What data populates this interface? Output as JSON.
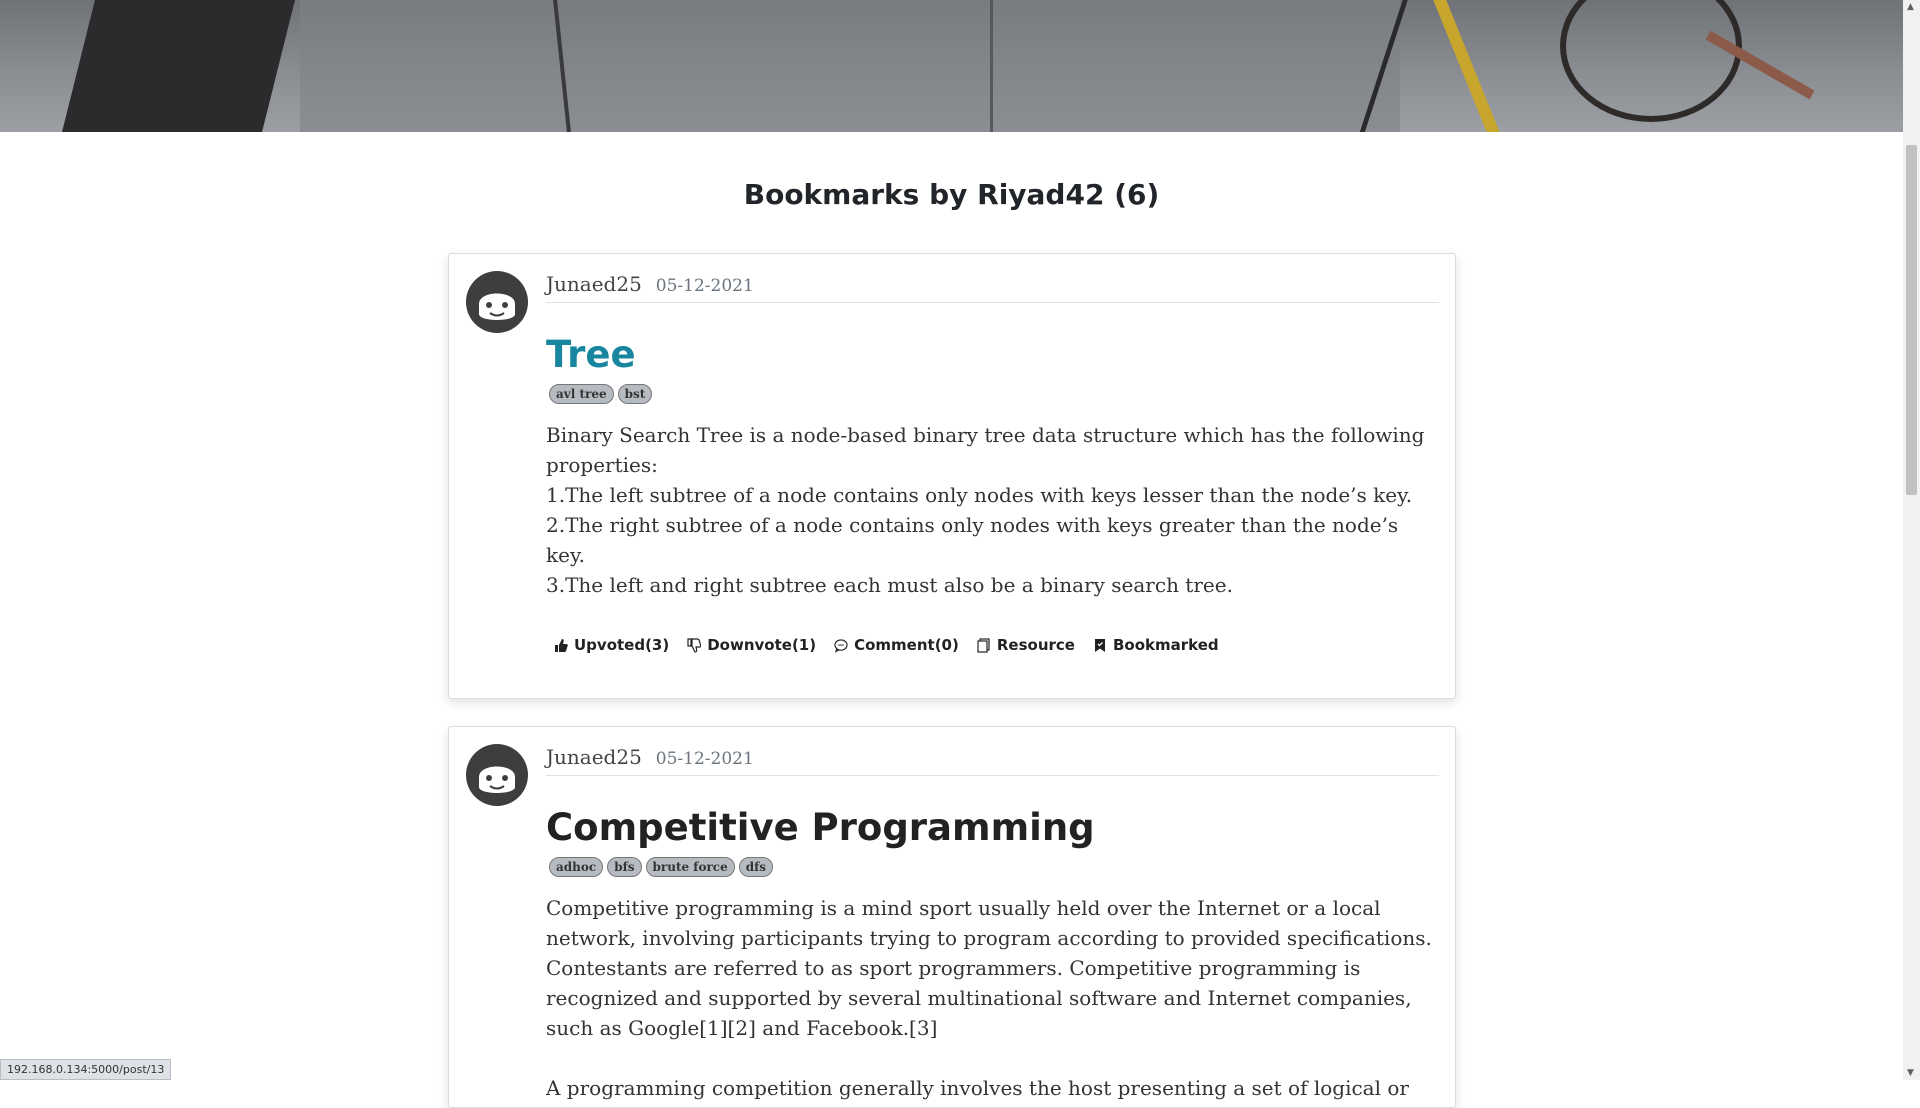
{
  "page": {
    "title": "Bookmarks by Riyad42 (6)"
  },
  "posts": [
    {
      "author": "Junaed25",
      "date": "05-12-2021",
      "title": "Tree",
      "tags": [
        "avl tree",
        "bst"
      ],
      "body": [
        "Binary Search Tree is a node-based binary tree data structure which has the following properties:",
        "1.The left subtree of a node contains only nodes with keys lesser than the node’s key.",
        "2.The right subtree of a node contains only nodes with keys greater than the node’s key.",
        "3.The left and right subtree each must also be a binary search tree."
      ],
      "actions": {
        "upvote": "Upvoted(3)",
        "downvote": "Downvote(1)",
        "comment": "Comment(0)",
        "resource": "Resource",
        "bookmark": "Bookmarked"
      }
    },
    {
      "author": "Junaed25",
      "date": "05-12-2021",
      "title": "Competitive Programming",
      "tags": [
        "adhoc",
        "bfs",
        "brute force",
        "dfs"
      ],
      "body": [
        "Competitive programming is a mind sport usually held over the Internet or a local network, involving participants trying to program according to provided specifications. Contestants are referred to as sport programmers. Competitive programming is recognized and supported by several multinational software and Internet companies, such as Google[1][2] and Facebook.[3]",
        "A programming competition generally involves the host presenting a set of logical or"
      ]
    }
  ],
  "status_bar": {
    "url": "192.168.0.134:5000/post/13"
  },
  "colors": {
    "title_link": "#17869e",
    "tag_bg": "#b6bbc1"
  }
}
